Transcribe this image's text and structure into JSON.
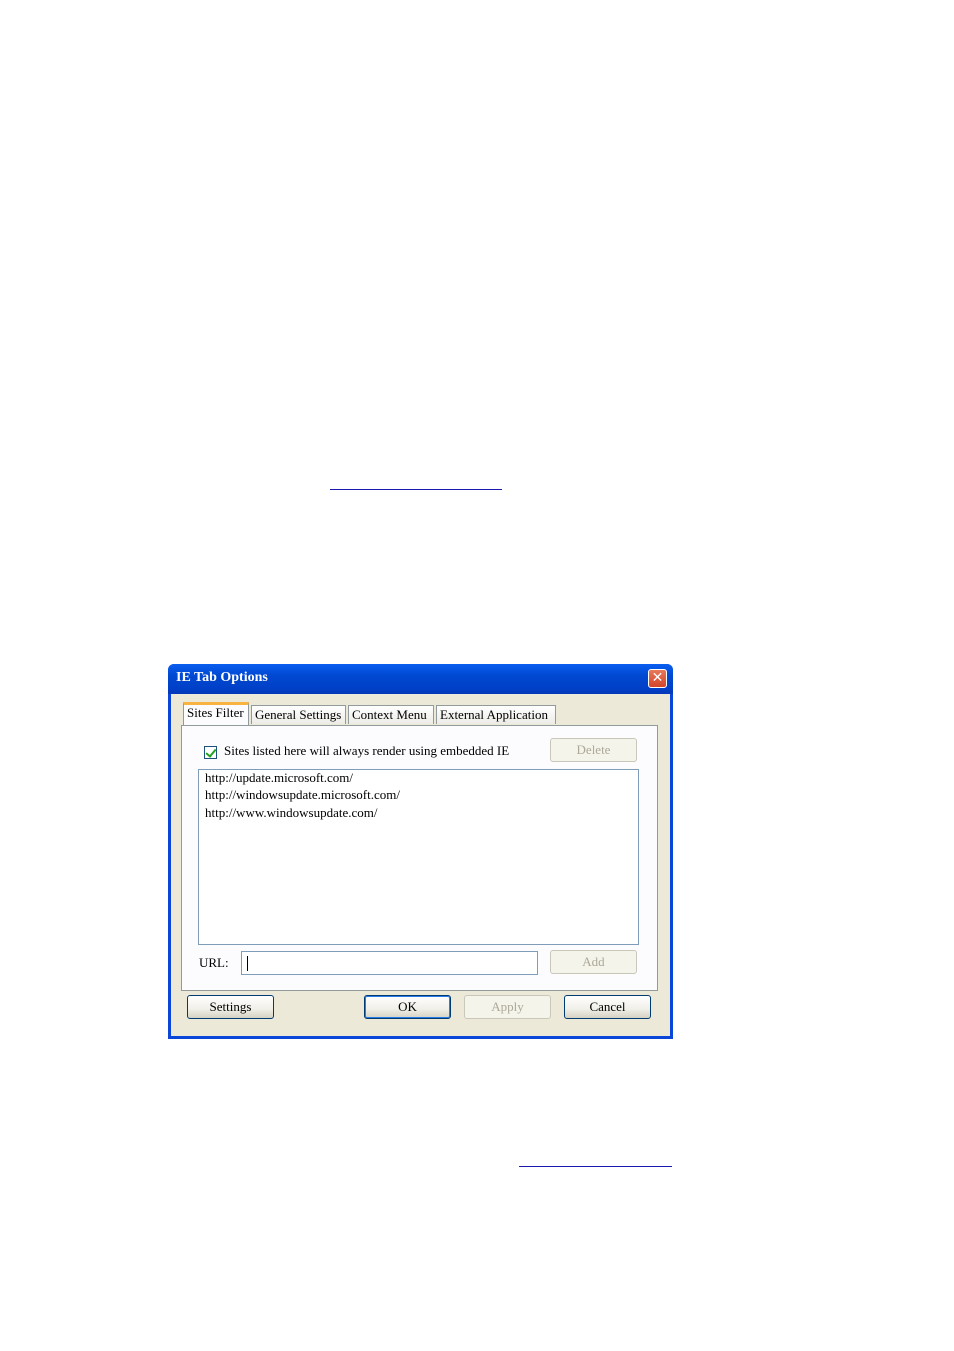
{
  "window": {
    "title": "IE Tab Options",
    "close_glyph": "✕"
  },
  "tabs": [
    {
      "label": "Sites Filter",
      "active": true
    },
    {
      "label": "General Settings",
      "active": false
    },
    {
      "label": "Context Menu",
      "active": false
    },
    {
      "label": "External Application",
      "active": false
    }
  ],
  "sites_filter": {
    "checkbox_checked": true,
    "checkbox_label": "Sites listed here will always render using embedded IE",
    "delete_label": "Delete",
    "sites": [
      "http://update.microsoft.com/",
      "http://windowsupdate.microsoft.com/",
      "http://www.windowsupdate.com/"
    ],
    "url_label": "URL:",
    "url_value": "",
    "add_label": "Add"
  },
  "footer": {
    "settings_label": "Settings",
    "ok_label": "OK",
    "apply_label": "Apply",
    "cancel_label": "Cancel"
  },
  "colors": {
    "titlebar": "#0a46d8",
    "dialog_bg": "#ece9d8",
    "close_button": "#d3442a",
    "active_tab_accent": "#f8b340"
  },
  "icons": {
    "close": "close-icon",
    "checkbox": "checkmark-icon"
  }
}
